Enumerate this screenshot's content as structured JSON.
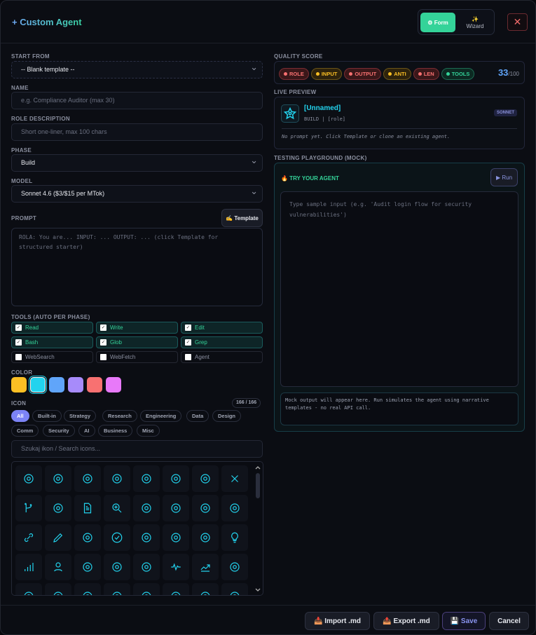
{
  "header": {
    "title": "+ Custom Agent",
    "mode_form": "⚙ Form",
    "mode_wizard_icon": "✨",
    "mode_wizard": "Wizard",
    "close": "✕"
  },
  "form": {
    "start_from": {
      "label": "START FROM",
      "value": "-- Blank template --"
    },
    "name": {
      "label": "NAME",
      "placeholder": "e.g. Compliance Auditor (max 30)"
    },
    "role": {
      "label": "ROLE DESCRIPTION",
      "placeholder": "Short one-liner, max 100 chars"
    },
    "phase": {
      "label": "PHASE",
      "value": "Build"
    },
    "model": {
      "label": "MODEL",
      "value": "Sonnet 4.6 ($3/$15 per MTok)"
    },
    "prompt": {
      "label": "PROMPT",
      "template_button": "✍ Template",
      "placeholder": "ROLA: You are... INPUT: ... OUTPUT: ... (click Template for structured starter)"
    },
    "tools": {
      "label": "TOOLS (AUTO PER PHASE)",
      "items": [
        {
          "name": "Read",
          "checked": true
        },
        {
          "name": "Write",
          "checked": true
        },
        {
          "name": "Edit",
          "checked": true
        },
        {
          "name": "Bash",
          "checked": true
        },
        {
          "name": "Glob",
          "checked": true
        },
        {
          "name": "Grep",
          "checked": true
        },
        {
          "name": "WebSearch",
          "checked": false
        },
        {
          "name": "WebFetch",
          "checked": false
        },
        {
          "name": "Agent",
          "checked": false
        }
      ]
    },
    "color": {
      "label": "COLOR",
      "selected": 1,
      "swatches": [
        "#fbbf24",
        "#22d3ee",
        "#60a5fa",
        "#a78bfa",
        "#f87171",
        "#e879f9"
      ]
    },
    "icon": {
      "label": "ICON",
      "count": "166 / 166",
      "categories": [
        "All",
        "Built-in",
        "Strategy",
        "Research",
        "Engineering",
        "Data",
        "Design",
        "Comm",
        "Security",
        "AI",
        "Business",
        "Misc"
      ],
      "active_category": "All",
      "search_placeholder": "Szukaj ikon / Search icons...",
      "icons": [
        "flame",
        "hierarchy",
        "scatter",
        "route",
        "terminal",
        "target",
        "chat",
        "close",
        "git-branch",
        "book",
        "document",
        "zoom-in",
        "server",
        "browser",
        "wand",
        "compass",
        "link",
        "pencil",
        "shield-lock",
        "check-circle",
        "gauge",
        "clipboard",
        "wrench",
        "lightbulb",
        "bar-signal",
        "user",
        "droplet",
        "network",
        "database",
        "pulse",
        "trend-up",
        "bar-chart",
        "chart-2",
        "grid",
        "dots",
        "crown",
        "clock",
        "flag",
        "radar",
        "bracket"
      ]
    }
  },
  "quality": {
    "label": "QUALITY SCORE",
    "score": "33",
    "max": "/100",
    "checks": [
      {
        "name": "ROLE",
        "status": "fail"
      },
      {
        "name": "INPUT",
        "status": "warn"
      },
      {
        "name": "OUTPUT",
        "status": "fail"
      },
      {
        "name": "ANTI",
        "status": "warn"
      },
      {
        "name": "LEN",
        "status": "fail"
      },
      {
        "name": "TOOLS",
        "status": "pass"
      }
    ]
  },
  "preview": {
    "label": "LIVE PREVIEW",
    "name": "[Unnamed]",
    "meta": "BUILD | [role]",
    "badge": "SONNET",
    "prompt": "No prompt yet. Click Template or clone an existing agent."
  },
  "playground": {
    "label": "TESTING PLAYGROUND (MOCK)",
    "title": "🔥 TRY YOUR AGENT",
    "run": "▶ Run",
    "input_placeholder": "Type sample input (e.g. 'Audit login flow for security vulnerabilities')",
    "output": "Mock output will appear here. Run simulates the agent using narrative templates - no real API call."
  },
  "footer": {
    "import": "📥 Import .md",
    "export": "📤 Export .md",
    "save": "💾 Save",
    "cancel": "Cancel"
  },
  "colors": {
    "accent": "#34d399",
    "cyan": "#22d3ee",
    "indigo": "#7c83f5"
  }
}
